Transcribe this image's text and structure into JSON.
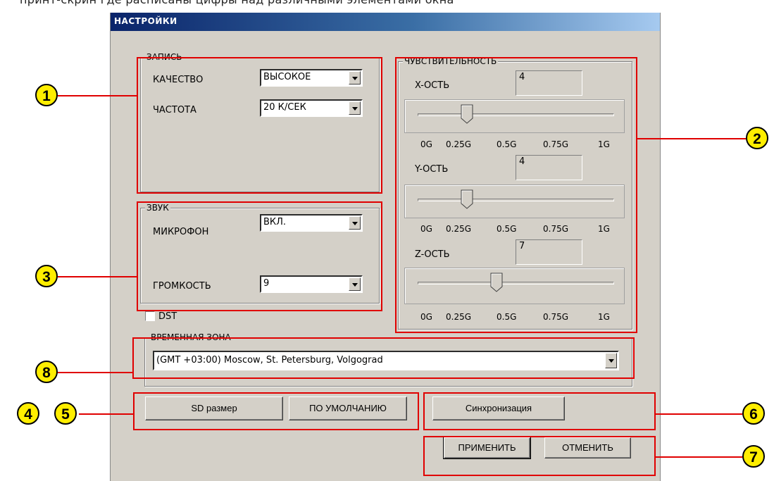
{
  "top_text": "принт-скрин где расписаны цифры над различными элементами окна",
  "window": {
    "title": "НАСТРОЙКИ"
  },
  "recording": {
    "legend": "ЗАПИСЬ",
    "quality_label": "КАЧЕСТВО",
    "quality_value": "ВЫСОКОЕ",
    "rate_label": "ЧАСТОТА",
    "rate_value": "20 К/СЕК"
  },
  "sound": {
    "legend": "ЗВУК",
    "mic_label": "МИКРОФОН",
    "mic_value": "ВКЛ.",
    "volume_label": "ГРОМКОСТЬ",
    "volume_value": "9"
  },
  "dst": {
    "label": "DST",
    "checked": false
  },
  "sensitivity": {
    "legend": "ЧУВСТВИТЕЛЬНОСТЬ",
    "axes": [
      {
        "label": "X-ОСТЬ",
        "value": "4",
        "slider_level": 0.25
      },
      {
        "label": "Y-ОСТЬ",
        "value": "4",
        "slider_level": 0.25
      },
      {
        "label": "Z-ОСТЬ",
        "value": "7",
        "slider_level": 0.4
      }
    ],
    "ticks": [
      "0G",
      "0.25G",
      "0.5G",
      "0.75G",
      "1G"
    ]
  },
  "timezone": {
    "legend": "ВРЕМЕННАЯ ЗОНА",
    "value": "(GMT +03:00) Moscow, St. Petersburg, Volgograd"
  },
  "buttons": {
    "sd_size": "SD размер",
    "defaults": "ПО УМОЛЧАНИЮ",
    "sync": "Синхронизация",
    "apply": "ПРИМЕНИТЬ",
    "cancel": "ОТМЕНИТЬ"
  },
  "callouts": [
    "1",
    "2",
    "3",
    "4",
    "5",
    "6",
    "7",
    "8"
  ],
  "colors": {
    "annotation": "#e00000",
    "badge": "#ffee00",
    "dialog": "#d4d0c8"
  }
}
